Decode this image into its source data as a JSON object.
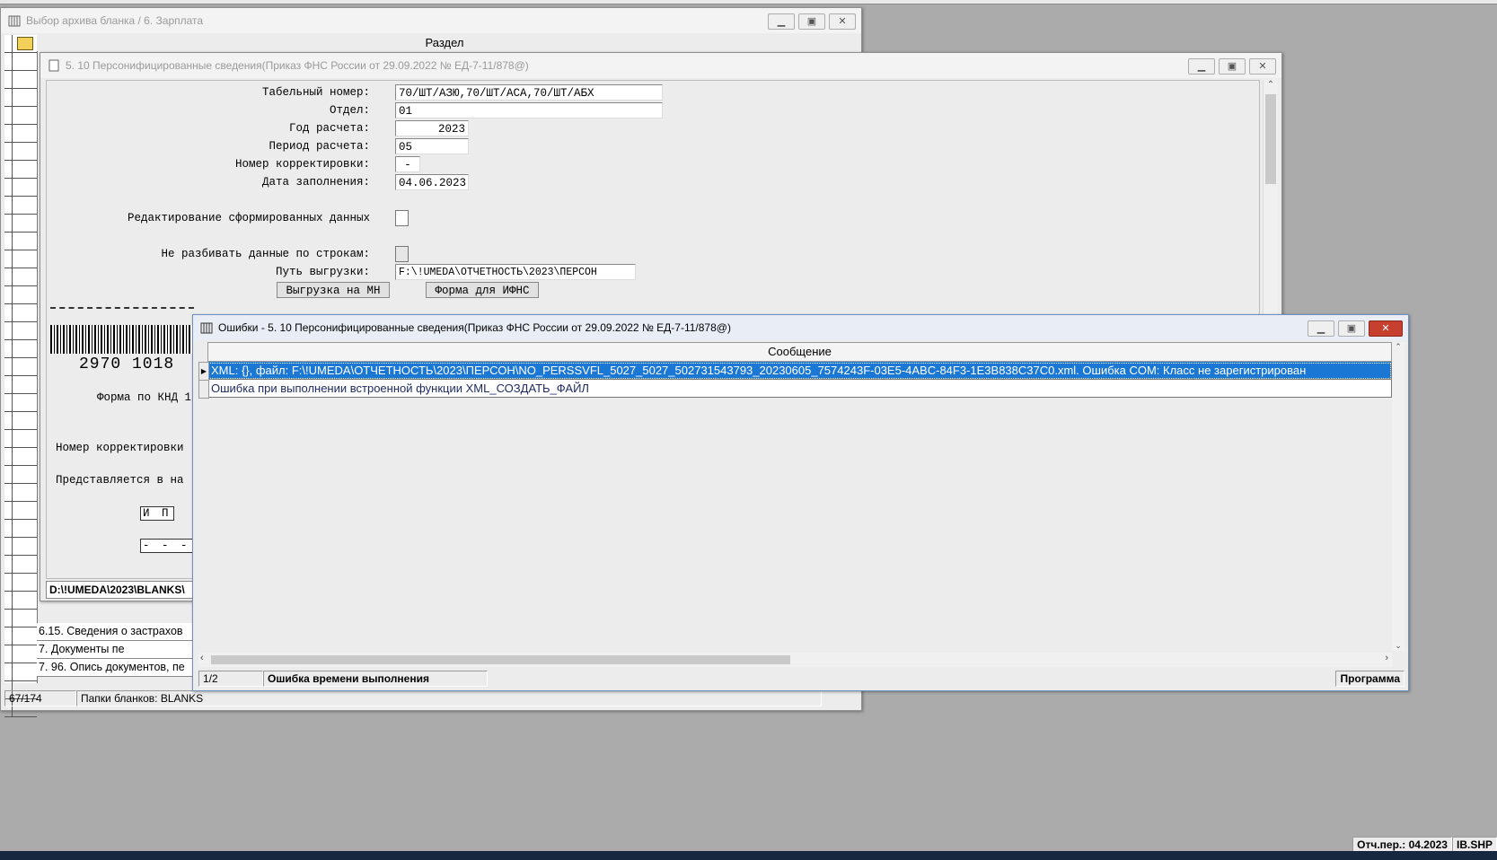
{
  "archive_window": {
    "title": "Выбор архива бланка /    6. Зарплата",
    "section_header": "Раздел",
    "list_items": [
      "6.15.   Сведения о застрахов",
      "7.                    Документы пе",
      "7. 96. Опись документов, пе"
    ],
    "status": {
      "counter": "67/174",
      "folder": "Папки бланков: BLANKS"
    }
  },
  "form_window": {
    "title": "5. 10 Персонифицированные сведения(Приказ ФНС России от 29.09.2022 № ЕД-7-11/878@)",
    "fields": {
      "tab_number": {
        "label": "Табельный номер:",
        "value": "70/ШТ/АЗЮ,70/ШТ/АСА,70/ШТ/АБХ"
      },
      "department": {
        "label": "Отдел:",
        "value": "01"
      },
      "year": {
        "label": "Год расчета:",
        "value": "2023"
      },
      "period": {
        "label": "Период расчета:",
        "value": "05"
      },
      "correction": {
        "label": "Номер корректировки:",
        "value": "-"
      },
      "fill_date": {
        "label": "Дата заполнения:",
        "value": "04.06.2023"
      },
      "edit_generated": {
        "label": "Редактирование сформированных данных"
      },
      "no_split": {
        "label": "Не разбивать данные по строкам:"
      },
      "export_path": {
        "label": "Путь выгрузки:",
        "value": "F:\\!UMEDA\\ОТЧЕТНОСТЬ\\2023\\ПЕРСОН"
      }
    },
    "buttons": {
      "export_mn": "Выгрузка на МН",
      "form_ifns": "Форма для ИФНС"
    },
    "preview": {
      "barcode_number": "2970 1018",
      "knd_text": "Форма по КНД 1",
      "correction_text": "Номер корректировки",
      "submitted_text": "Представляется в на",
      "cells_ip": "И П",
      "cells_dash": "- - - -"
    },
    "path_bar": "D:\\!UMEDA\\2023\\BLANKS\\"
  },
  "errors_window": {
    "title": "Ошибки - 5. 10 Персонифицированные сведения(Приказ ФНС России от 29.09.2022 № ЕД-7-11/878@)",
    "column_header": "Сообщение",
    "rows": [
      "XML: {}, файл: F:\\!UMEDA\\ОТЧЕТНОСТЬ\\2023\\ПЕРСОН\\NO_PERSSVFL_5027_5027_502731543793_20230605_7574243F-03E5-4ABC-84F3-1E3B838C37C0.xml. Ошибка COM: Класс не зарегистрирован",
      "Ошибка при выполнении встроенной функции XML_СОЗДАТЬ_ФАЙЛ"
    ],
    "status": {
      "counter": "1/2",
      "message": "Ошибка времени выполнения",
      "source": "Программа"
    }
  },
  "main_status": {
    "period": "Отч.пер.: 04.2023",
    "db": "IB.SHP"
  },
  "colors": {
    "selection": "#1a77d4",
    "close_button": "#c7402f",
    "background": "#ababab"
  }
}
